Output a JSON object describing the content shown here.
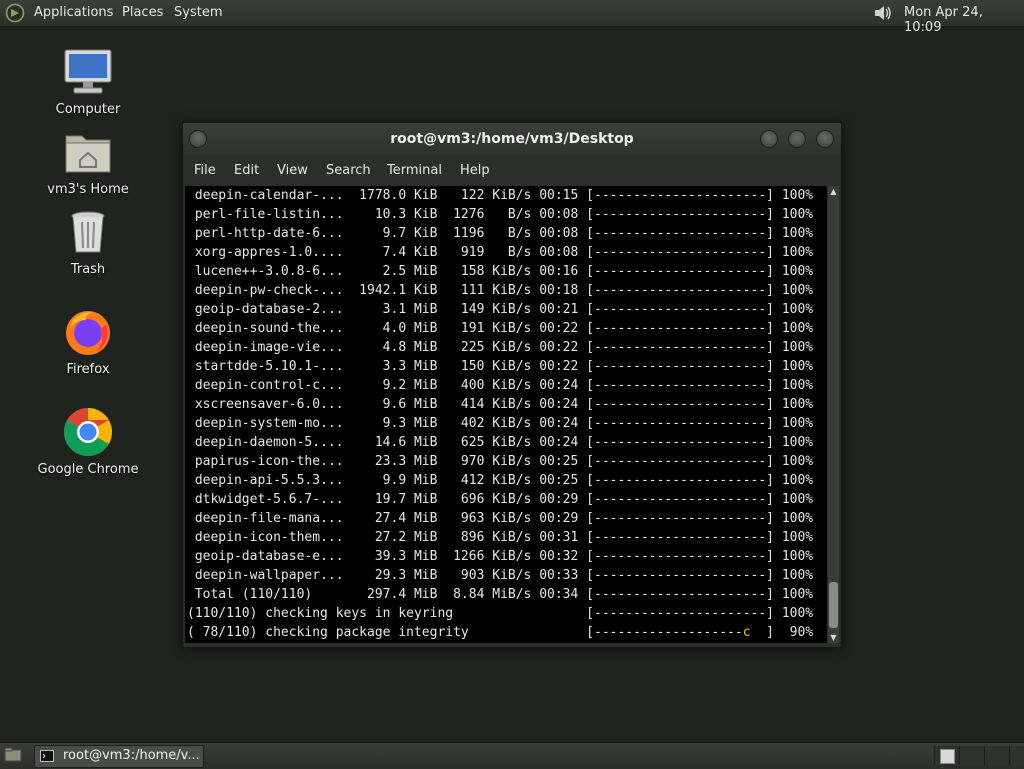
{
  "top_panel": {
    "menus": [
      "Applications",
      "Places",
      "System"
    ],
    "clock": "Mon Apr 24, 10:09"
  },
  "desktop_icons": [
    {
      "label": "Computer"
    },
    {
      "label": "vm3's Home"
    },
    {
      "label": "Trash"
    },
    {
      "label": "Firefox"
    },
    {
      "label": "Google Chrome"
    }
  ],
  "terminal": {
    "title": "root@vm3:/home/vm3/Desktop",
    "menus": [
      "File",
      "Edit",
      "View",
      "Search",
      "Terminal",
      "Help"
    ],
    "lines": [
      " deepin-calendar-...  1778.0 KiB   122 KiB/s 00:15 [----------------------] 100%",
      " perl-file-listin...    10.3 KiB  1276   B/s 00:08 [----------------------] 100%",
      " perl-http-date-6...     9.7 KiB  1196   B/s 00:08 [----------------------] 100%",
      " xorg-appres-1.0....     7.4 KiB   919   B/s 00:08 [----------------------] 100%",
      " lucene++-3.0.8-6...     2.5 MiB   158 KiB/s 00:16 [----------------------] 100%",
      " deepin-pw-check-...  1942.1 KiB   111 KiB/s 00:18 [----------------------] 100%",
      " geoip-database-2...     3.1 MiB   149 KiB/s 00:21 [----------------------] 100%",
      " deepin-sound-the...     4.0 MiB   191 KiB/s 00:22 [----------------------] 100%",
      " deepin-image-vie...     4.8 MiB   225 KiB/s 00:22 [----------------------] 100%",
      " startdde-5.10.1-...     3.3 MiB   150 KiB/s 00:22 [----------------------] 100%",
      " deepin-control-c...     9.2 MiB   400 KiB/s 00:24 [----------------------] 100%",
      " xscreensaver-6.0...     9.6 MiB   414 KiB/s 00:24 [----------------------] 100%",
      " deepin-system-mo...     9.3 MiB   402 KiB/s 00:24 [----------------------] 100%",
      " deepin-daemon-5....    14.6 MiB   625 KiB/s 00:24 [----------------------] 100%",
      " papirus-icon-the...    23.3 MiB   970 KiB/s 00:25 [----------------------] 100%",
      " deepin-api-5.5.3...     9.9 MiB   412 KiB/s 00:25 [----------------------] 100%",
      " dtkwidget-5.6.7-...    19.7 MiB   696 KiB/s 00:29 [----------------------] 100%",
      " deepin-file-mana...    27.4 MiB   963 KiB/s 00:29 [----------------------] 100%",
      " deepin-icon-them...    27.2 MiB   896 KiB/s 00:31 [----------------------] 100%",
      " geoip-database-e...    39.3 MiB  1266 KiB/s 00:32 [----------------------] 100%",
      " deepin-wallpaper...    29.3 MiB   903 KiB/s 00:33 [----------------------] 100%",
      " Total (110/110)       297.4 MiB  8.84 MiB/s 00:34 [----------------------] 100%",
      "(110/110) checking keys in keyring                 [----------------------] 100%"
    ],
    "last_line_prefix": "( 78/110) checking package integrity               [-------------------",
    "last_line_pacman": "c",
    "last_line_suffix": "  ]  90%"
  },
  "taskbar": {
    "task_label": "root@vm3:/home/v..."
  }
}
